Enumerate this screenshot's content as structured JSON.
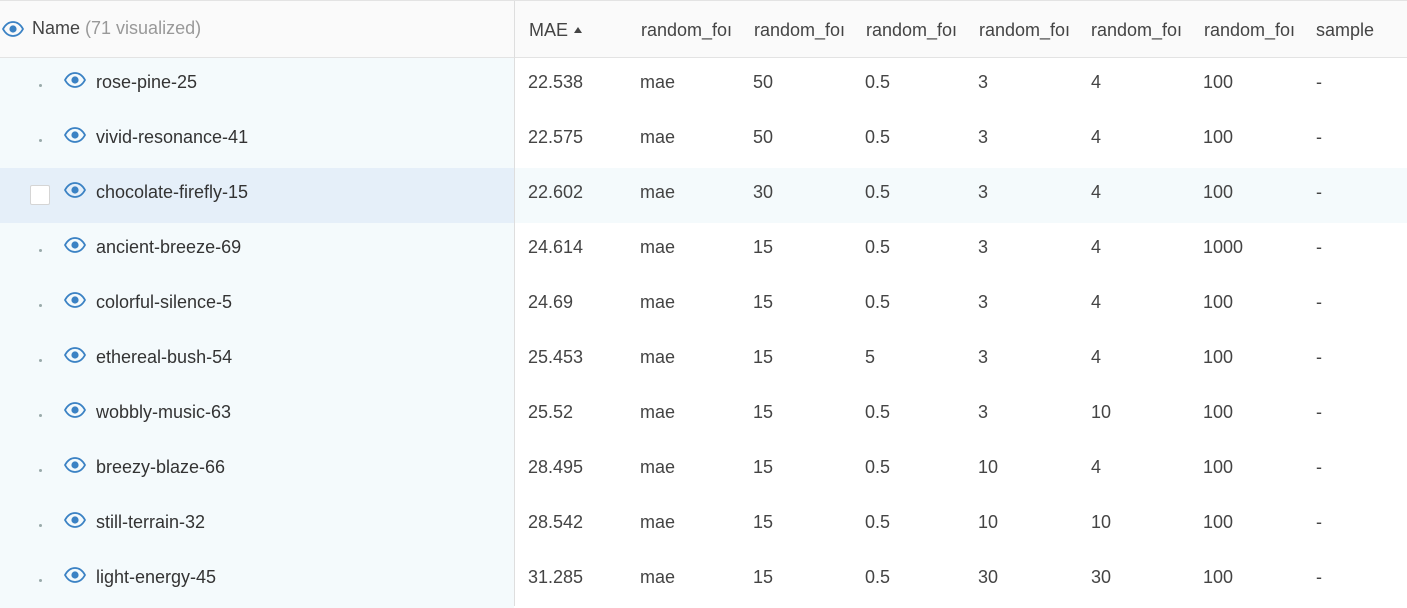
{
  "header": {
    "name_label": "Name",
    "visualized_count": "(71 visualized)",
    "columns": [
      "MAE",
      "random_foı",
      "random_foı",
      "random_foı",
      "random_foı",
      "random_foı",
      "random_foı",
      "sample"
    ],
    "sort": {
      "column": "MAE",
      "direction": "ascending"
    }
  },
  "colors": {
    "accent": "#3b82c4",
    "name_column_bg": "#f4fafc",
    "hover_row_bg": "#e5eff9"
  },
  "rows": [
    {
      "name": "rose-pine-25",
      "values": [
        "22.538",
        "mae",
        "50",
        "0.5",
        "3",
        "4",
        "100",
        "-"
      ]
    },
    {
      "name": "vivid-resonance-41",
      "values": [
        "22.575",
        "mae",
        "50",
        "0.5",
        "3",
        "4",
        "100",
        "-"
      ]
    },
    {
      "name": "chocolate-firefly-15",
      "values": [
        "22.602",
        "mae",
        "30",
        "0.5",
        "3",
        "4",
        "100",
        "-"
      ],
      "hovered": true
    },
    {
      "name": "ancient-breeze-69",
      "values": [
        "24.614",
        "mae",
        "15",
        "0.5",
        "3",
        "4",
        "1000",
        "-"
      ]
    },
    {
      "name": "colorful-silence-5",
      "values": [
        "24.69",
        "mae",
        "15",
        "0.5",
        "3",
        "4",
        "100",
        "-"
      ]
    },
    {
      "name": "ethereal-bush-54",
      "values": [
        "25.453",
        "mae",
        "15",
        "5",
        "3",
        "4",
        "100",
        "-"
      ]
    },
    {
      "name": "wobbly-music-63",
      "values": [
        "25.52",
        "mae",
        "15",
        "0.5",
        "3",
        "10",
        "100",
        "-"
      ]
    },
    {
      "name": "breezy-blaze-66",
      "values": [
        "28.495",
        "mae",
        "15",
        "0.5",
        "10",
        "4",
        "100",
        "-"
      ]
    },
    {
      "name": "still-terrain-32",
      "values": [
        "28.542",
        "mae",
        "15",
        "0.5",
        "10",
        "10",
        "100",
        "-"
      ]
    },
    {
      "name": "light-energy-45",
      "values": [
        "31.285",
        "mae",
        "15",
        "0.5",
        "30",
        "30",
        "100",
        "-"
      ]
    }
  ]
}
